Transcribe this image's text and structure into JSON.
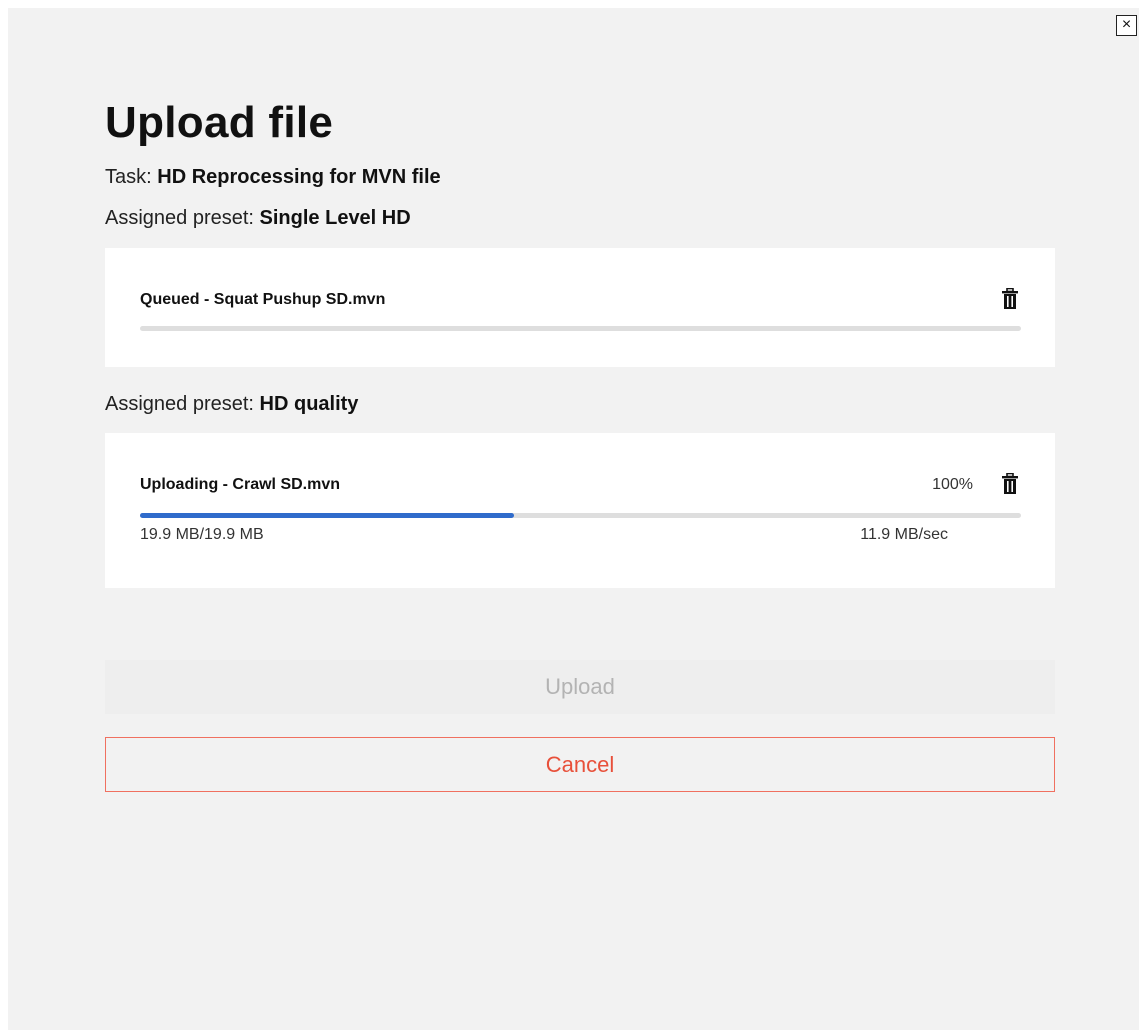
{
  "dialog": {
    "close_label": "×",
    "title": "Upload file",
    "task_label": "Task: ",
    "task_value": "HD Reprocessing for MVN file"
  },
  "groups": [
    {
      "preset_label": "Assigned preset: ",
      "preset_value": "Single Level HD",
      "file": {
        "title": "Queued - Squat Pushup SD.mvn",
        "progress": 0
      }
    },
    {
      "preset_label": "Assigned preset: ",
      "preset_value": "HD quality",
      "file": {
        "title": "Uploading - Crawl SD.mvn",
        "percent": "100%",
        "progress": 0.424,
        "size": "19.9 MB/19.9 MB",
        "speed": "11.9 MB/sec"
      }
    }
  ],
  "buttons": {
    "upload": "Upload",
    "cancel": "Cancel"
  },
  "icons": {
    "close": "close-icon",
    "delete": "trash-icon"
  },
  "colors": {
    "progress": "#2f6bcb",
    "cancel": "#e8503a"
  }
}
